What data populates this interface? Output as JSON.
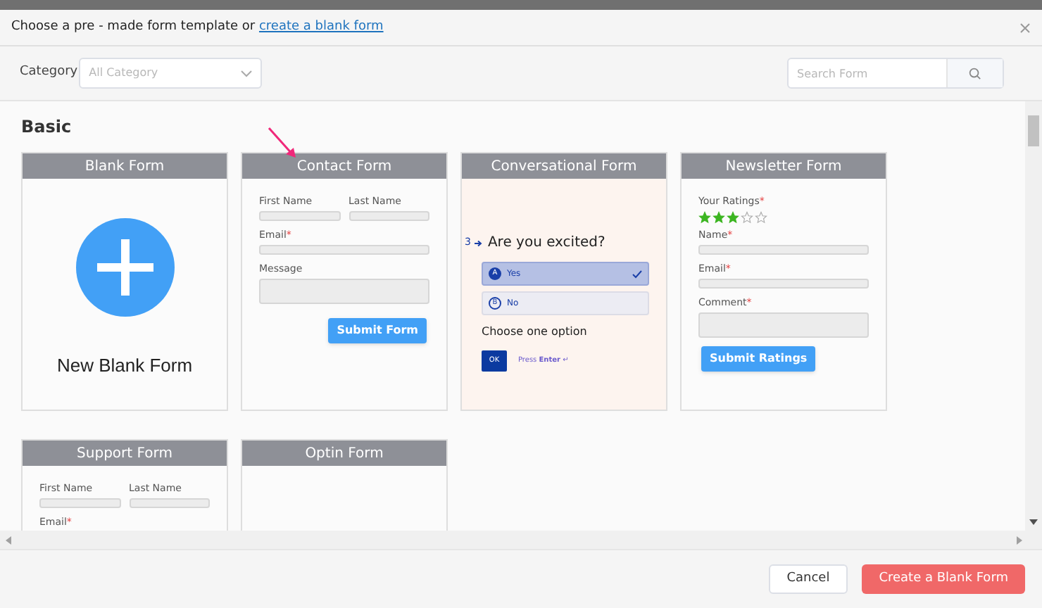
{
  "dialog": {
    "title_text": "Choose a pre - made form template or ",
    "title_link": "create a blank form"
  },
  "toolbar": {
    "category_label": "Category",
    "category_placeholder": "All Category",
    "search_placeholder": "Search Form"
  },
  "section": "Basic",
  "templates": [
    {
      "kind": "blank",
      "title": "Blank Form",
      "label": "New Blank Form"
    },
    {
      "kind": "form",
      "title": "Contact Form",
      "rows": [
        {
          "kind": "pair",
          "fields": [
            {
              "label": "First Name"
            },
            {
              "label": "Last Name"
            }
          ]
        },
        {
          "kind": "input",
          "label": "Email",
          "mark": "*"
        },
        {
          "kind": "textarea",
          "label": "Message"
        }
      ],
      "button": "Submit Form"
    },
    {
      "kind": "conversational",
      "title": "Conversational Form",
      "number": "3",
      "question": "Are you excited?",
      "options": [
        {
          "key": "A",
          "label": "Yes",
          "selected": true
        },
        {
          "key": "B",
          "label": "No",
          "selected": false
        }
      ],
      "hint": "Choose one option",
      "button": "OK",
      "press": "Press **Enter** ↵"
    },
    {
      "kind": "rating_form",
      "title": "Newsletter Form",
      "rows": [
        {
          "kind": "rating",
          "label": "Your Ratings",
          "mark": "*",
          "stars": 3
        },
        {
          "kind": "input",
          "label": "Name",
          "mark": "*"
        },
        {
          "kind": "input",
          "label": "Email",
          "mark": "*"
        },
        {
          "kind": "textarea",
          "label": "Comment",
          "mark": "*"
        }
      ],
      "button": "Submit Ratings"
    },
    {
      "kind": "form",
      "title": "Support Form",
      "rows": [
        {
          "kind": "pair",
          "fields": [
            {
              "label": "First Name"
            },
            {
              "label": "Last Name"
            }
          ]
        },
        {
          "kind": "input",
          "label": "Email",
          "mark": "*"
        }
      ]
    },
    {
      "kind": "empty",
      "title": "Optin Form"
    }
  ],
  "footer": {
    "cancel": "Cancel",
    "create": "Create a Blank Form"
  }
}
